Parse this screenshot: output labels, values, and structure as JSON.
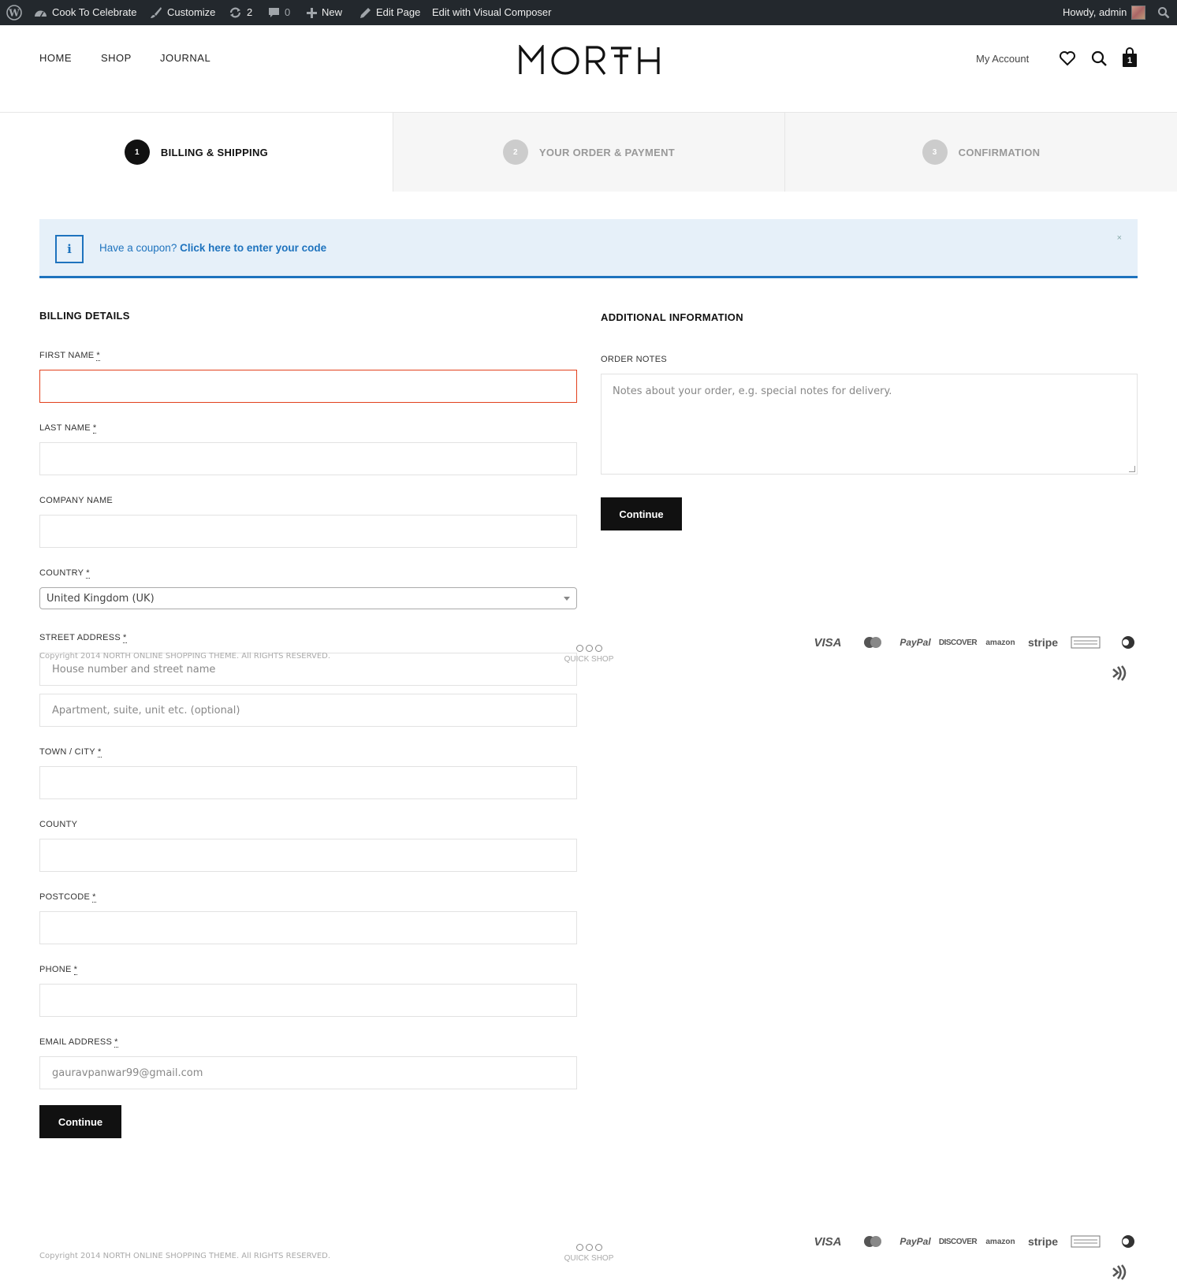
{
  "adminbar": {
    "site_name": "Cook To Celebrate",
    "customize": "Customize",
    "updates_count": "2",
    "comments_count": "0",
    "new": "New",
    "edit_page": "Edit Page",
    "visual_composer": "Edit with Visual Composer",
    "howdy": "Howdy, admin"
  },
  "header": {
    "nav": [
      "HOME",
      "SHOP",
      "JOURNAL"
    ],
    "logo": "MORTH",
    "my_account": "My Account",
    "cart_count": "1"
  },
  "steps": [
    {
      "num": "1",
      "label": "BILLING & SHIPPING",
      "state": "active"
    },
    {
      "num": "2",
      "label": "YOUR ORDER & PAYMENT",
      "state": "inactive"
    },
    {
      "num": "3",
      "label": "CONFIRMATION",
      "state": "inactive"
    }
  ],
  "coupon": {
    "prefix": "Have a coupon?",
    "link": "Click here to enter your code",
    "info_icon": "i",
    "close": "×"
  },
  "billing": {
    "title": "BILLING DETAILS",
    "req": "*",
    "first_name_label": "FIRST NAME",
    "last_name_label": "LAST NAME",
    "company_label": "COMPANY NAME",
    "country_label": "COUNTRY",
    "country_value": "United Kingdom (UK)",
    "street_label": "STREET ADDRESS",
    "street_placeholder": "House number and street name",
    "apartment_placeholder": "Apartment, suite, unit etc. (optional)",
    "town_label": "TOWN / CITY",
    "county_label": "COUNTY",
    "postcode_label": "POSTCODE",
    "phone_label": "PHONE",
    "email_label": "EMAIL ADDRESS",
    "email_value": "gauravpanwar99@gmail.com",
    "continue": "Continue"
  },
  "additional": {
    "title": "ADDITIONAL INFORMATION",
    "notes_label": "ORDER NOTES",
    "notes_placeholder": "Notes about your order, e.g. special notes for delivery.",
    "continue": "Continue"
  },
  "footer": {
    "copyright": "Copyright 2014 NORTH ONLINE SHOPPING THEME. All RIGHTS RESERVED.",
    "quick_shop": "QUICK SHOP",
    "payments": [
      "VISA",
      "MasterCard",
      "PayPal",
      "DISCOVER",
      "amazon",
      "stripe",
      "AMERICAN EXPRESS"
    ]
  },
  "colors": {
    "accent": "#1e73be",
    "error": "#e2401c",
    "dark": "#111111",
    "adminbar": "#23282d"
  }
}
